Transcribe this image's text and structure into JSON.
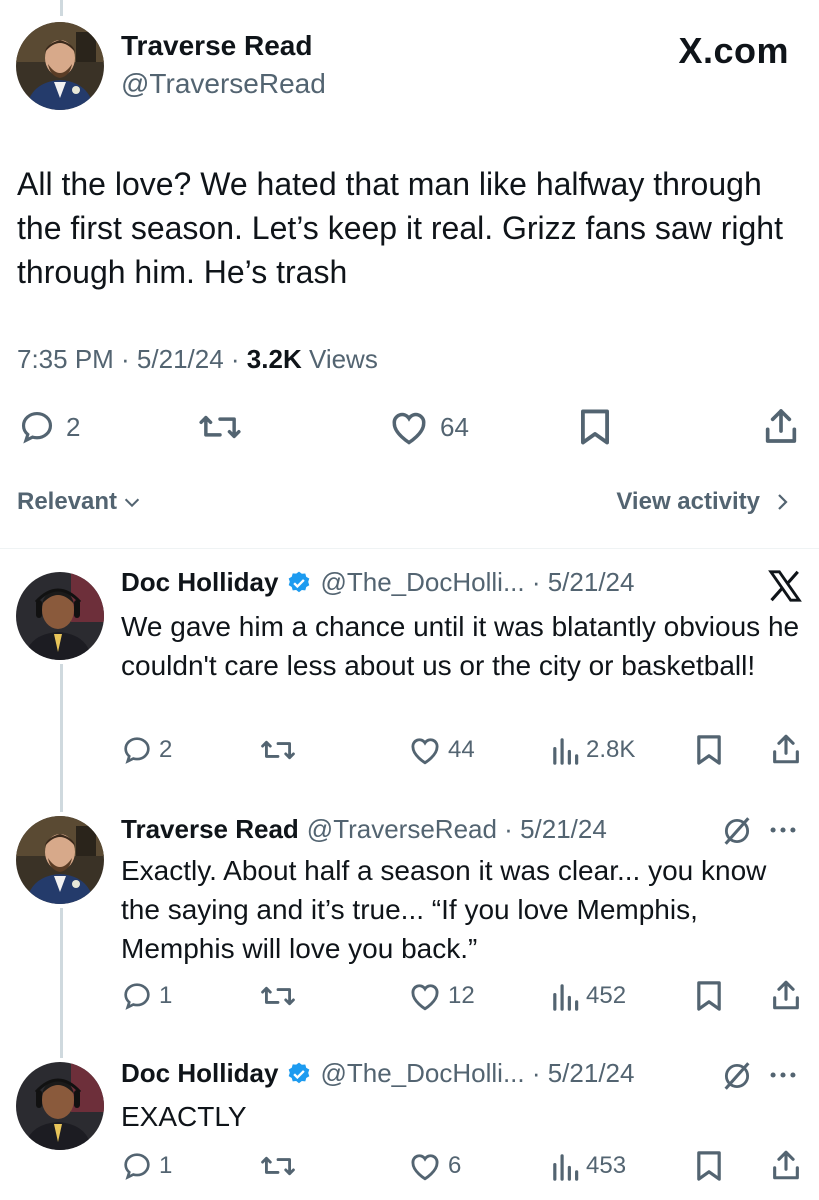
{
  "main_tweet": {
    "name": "Traverse Read",
    "handle": "@TraverseRead",
    "brand": "X.com",
    "text": "All the love? We hated that man like halfway through the first season. Let’s keep it real. Grizz fans saw right through him. He’s trash",
    "time": "7:35 PM · 5/21/24 · ",
    "views_count": "3.2K",
    "views_label": " Views",
    "replies": "2",
    "likes": "64"
  },
  "filter": {
    "relevant_label": "Relevant",
    "view_activity_label": "View activity"
  },
  "replies": [
    {
      "name": "Doc Holliday",
      "handle": "@The_DocHolli... · 5/21/24",
      "text": "We gave him a chance until it was blatantly obvious he couldn't care less about us or the city or basketball!",
      "replies": "2",
      "likes": "44",
      "views": "2.8K"
    },
    {
      "name": "Traverse Read",
      "handle": "@TraverseRead · 5/21/24",
      "text": "Exactly. About half a season it was clear... you know the saying and it’s true... “If you love Memphis, Memphis will love you back.”",
      "replies": "1",
      "likes": "12",
      "views": "452"
    },
    {
      "name": "Doc Holliday",
      "handle": "@The_DocHolli... · 5/21/24",
      "text": "EXACTLY",
      "replies": "1",
      "likes": "6",
      "views": "453"
    }
  ],
  "colors": {
    "text": "#0f1419",
    "secondary": "#536471",
    "verified": "#1d9bf0",
    "divider": "#eff3f4"
  }
}
